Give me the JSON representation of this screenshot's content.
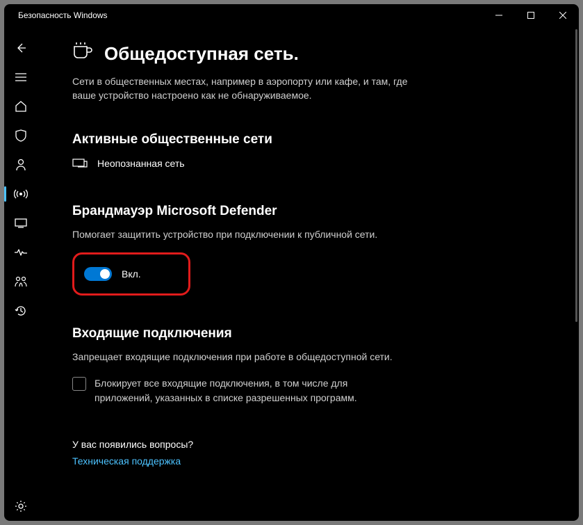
{
  "window": {
    "title": "Безопасность Windows"
  },
  "page": {
    "title": "Общедоступная сеть.",
    "description": "Сети в общественных местах, например в аэропорту или кафе, и там, где ваше устройство настроено как не обнаруживаемое."
  },
  "active_networks": {
    "title": "Активные общественные сети",
    "item": "Неопознанная сеть"
  },
  "firewall": {
    "title": "Брандмауэр Microsoft Defender",
    "description": "Помогает защитить устройство при подключении к публичной сети.",
    "toggle_label": "Вкл."
  },
  "incoming": {
    "title": "Входящие подключения",
    "description": "Запрещает входящие подключения при работе в общедоступной сети.",
    "checkbox_label": "Блокирует все входящие подключения, в том числе для приложений, указанных в списке разрешенных программ."
  },
  "help": {
    "title": "У вас появились вопросы?",
    "link": "Техническая поддержка"
  }
}
